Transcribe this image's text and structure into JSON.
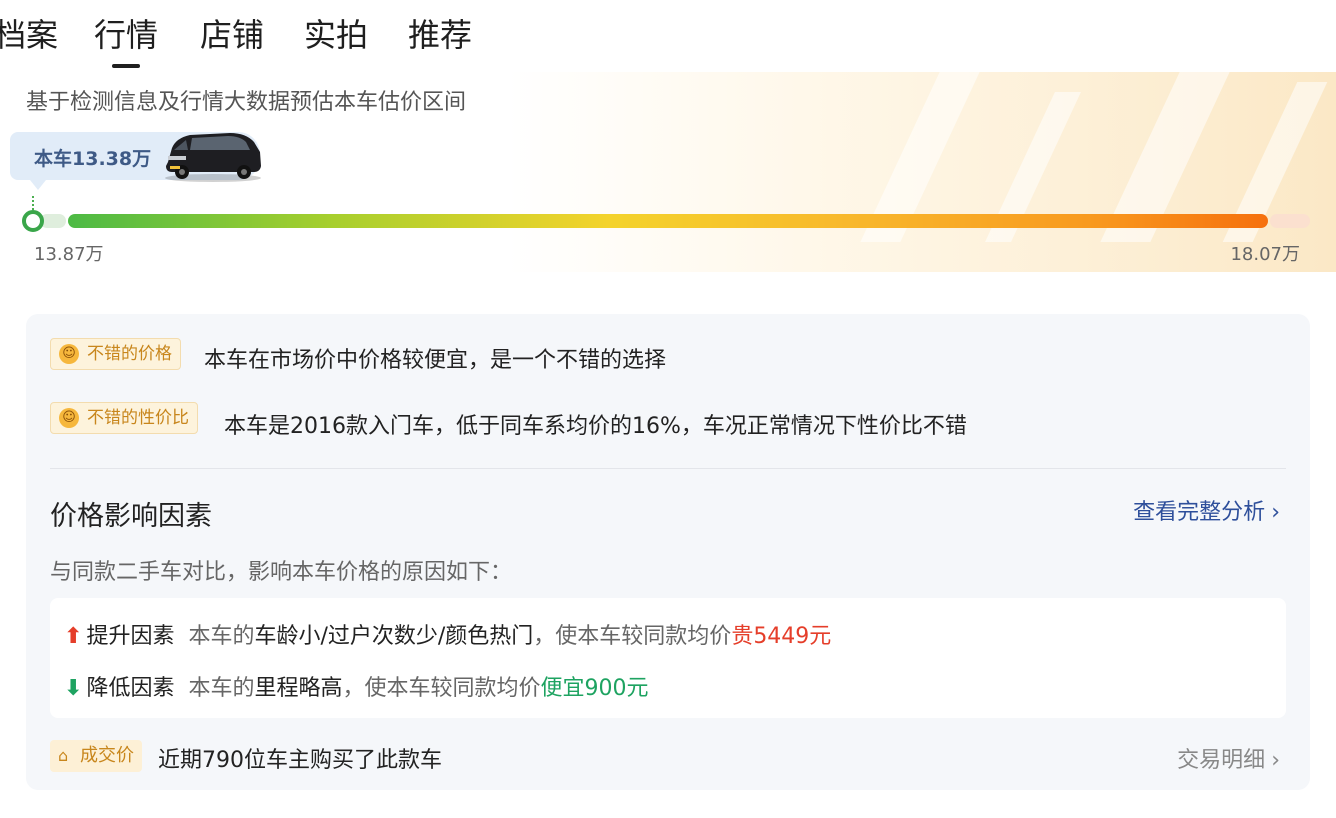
{
  "tabs": [
    {
      "label": "档案"
    },
    {
      "label": "行情"
    },
    {
      "label": "店铺"
    },
    {
      "label": "实拍"
    },
    {
      "label": "推荐"
    }
  ],
  "active_tab": "行情",
  "hero": {
    "subtitle": "基于检测信息及行情大数据预估本车估价区间",
    "car_price_label": "本车13.38万",
    "range_min": "13.87万",
    "range_max": "18.07万"
  },
  "badges": [
    {
      "label": "不错的价格",
      "text": "本车在市场价中价格较便宜，是一个不错的选择",
      "icon": "smile-icon"
    },
    {
      "label": "不错的性价比",
      "text": "本车是2016款入门车，低于同车系均价的16%，车况正常情况下性价比不错",
      "icon": "smile-icon"
    }
  ],
  "factors": {
    "title": "价格影响因素",
    "link_label": "查看完整分析",
    "note": "与同款二手车对比，影响本车价格的原因如下：",
    "up": {
      "label": "提升因素",
      "prefix": "本车的",
      "items": "车龄小/过户次数少/颜色热门",
      "middle": "，使本车较同款均价",
      "result": "贵5449元"
    },
    "down": {
      "label": "降低因素",
      "prefix": "本车的",
      "items": "里程略高",
      "middle": "，使本车较同款均价",
      "result": "便宜900元"
    }
  },
  "deal": {
    "badge_label": "成交价",
    "text": "近期790位车主购买了此款车",
    "link_label": "交易明细"
  },
  "colors": {
    "accent_blue": "#2e4f9b",
    "rise_red": "#e53e2a",
    "fall_green": "#1ea361",
    "badge_orange": "#c8861c"
  }
}
